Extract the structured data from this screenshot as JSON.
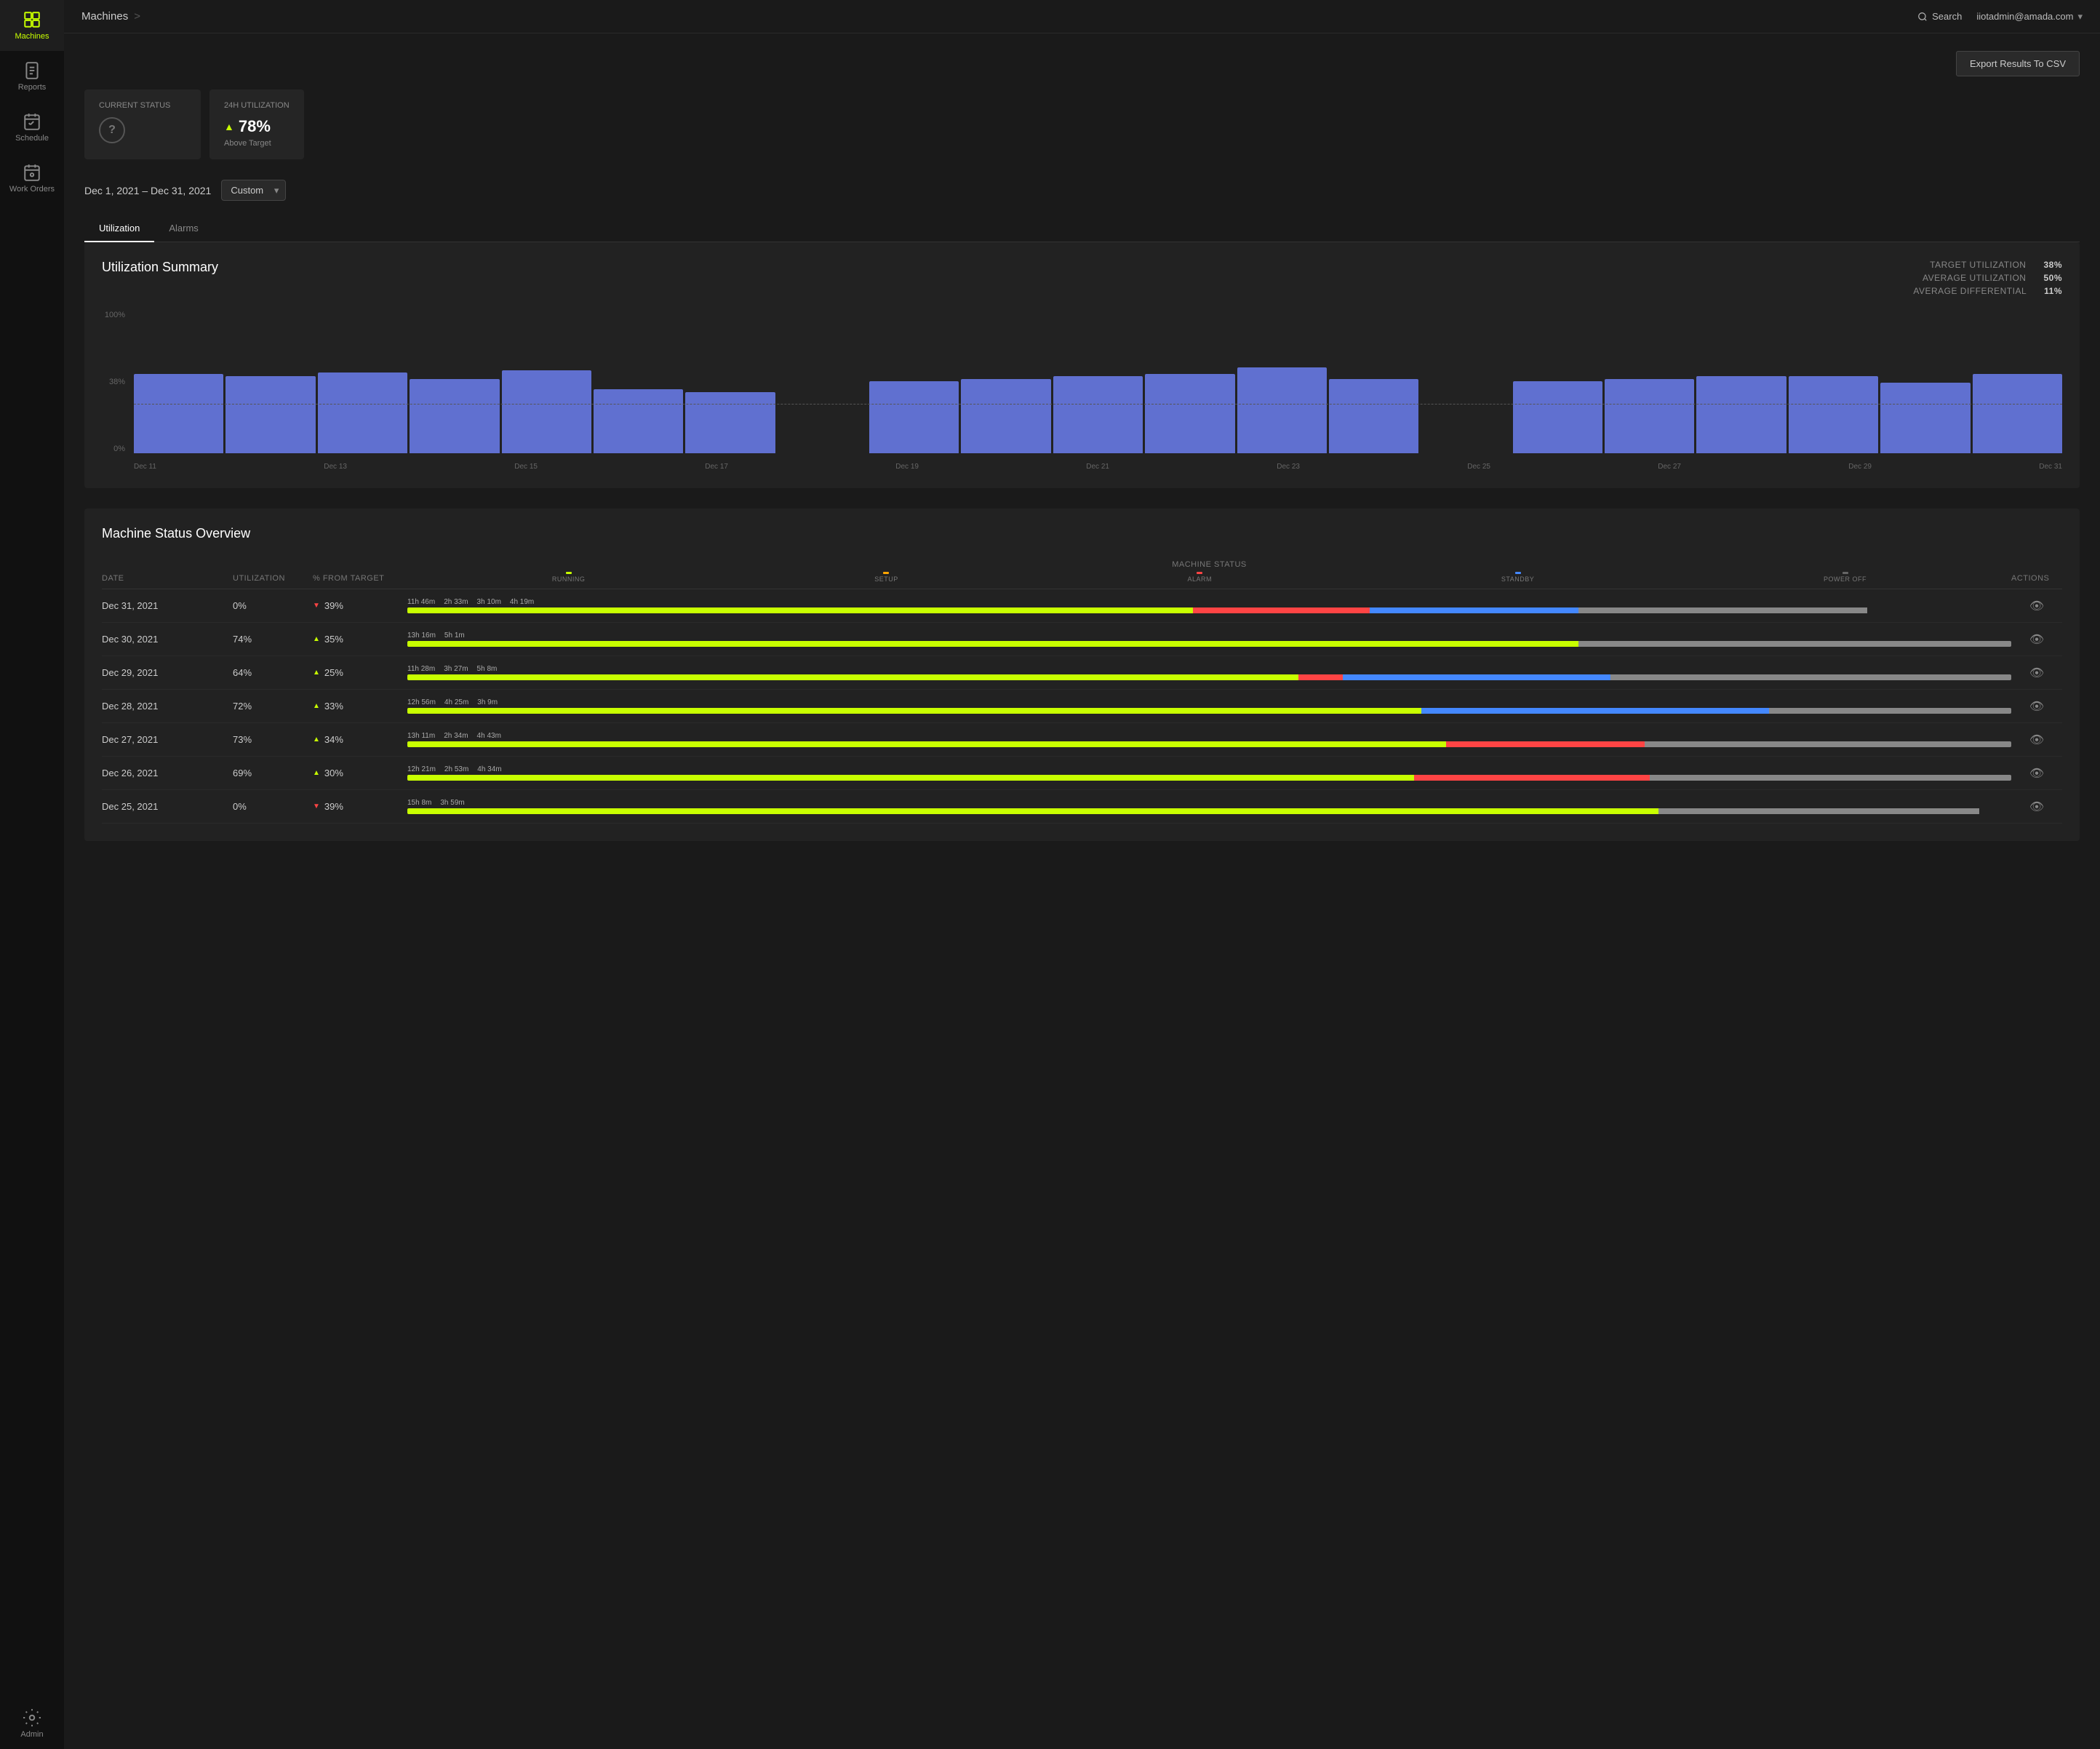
{
  "sidebar": {
    "items": [
      {
        "id": "machines",
        "label": "Machines",
        "active": true
      },
      {
        "id": "reports",
        "label": "Reports",
        "active": false
      },
      {
        "id": "schedule",
        "label": "Schedule",
        "active": false
      },
      {
        "id": "work-orders",
        "label": "Work Orders",
        "active": false
      }
    ],
    "admin_label": "Admin"
  },
  "topbar": {
    "breadcrumb": "Machines",
    "breadcrumb_sep": ">",
    "search_label": "Search",
    "user_email": "iiotadmin@amada.com"
  },
  "export_button": "Export Results To CSV",
  "status_cards": {
    "current_status": {
      "title": "Current Status",
      "icon": "?"
    },
    "utilization_24h": {
      "title": "24h Utilization",
      "value": "78%",
      "trend": "up",
      "label": "Above Target"
    }
  },
  "date_range": {
    "display": "Dec 1, 2021 – Dec 31, 2021",
    "filter_label": "Custom"
  },
  "tabs": [
    {
      "id": "utilization",
      "label": "Utilization",
      "active": true
    },
    {
      "id": "alarms",
      "label": "Alarms",
      "active": false
    }
  ],
  "chart": {
    "title": "Utilization Summary",
    "stats": {
      "target_label": "TARGET UTILIZATION",
      "target_val": "38%",
      "avg_label": "AVERAGE UTILIZATION",
      "avg_val": "50%",
      "diff_label": "AVERAGE DIFFERENTIAL",
      "diff_val": "11%"
    },
    "y_labels": [
      "100%",
      "38%",
      "0%"
    ],
    "target_pct": 38,
    "bars": [
      {
        "label": "Dec 11",
        "height": 62
      },
      {
        "label": "",
        "height": 60
      },
      {
        "label": "Dec 13",
        "height": 63
      },
      {
        "label": "",
        "height": 58
      },
      {
        "label": "Dec 15",
        "height": 65
      },
      {
        "label": "",
        "height": 50
      },
      {
        "label": "Dec 17",
        "height": 48
      },
      {
        "label": "",
        "height": 0
      },
      {
        "label": "Dec 19",
        "height": 56
      },
      {
        "label": "",
        "height": 58
      },
      {
        "label": "Dec 21",
        "height": 60
      },
      {
        "label": "",
        "height": 62
      },
      {
        "label": "Dec 23",
        "height": 67
      },
      {
        "label": "",
        "height": 58
      },
      {
        "label": "Dec 25",
        "height": 0
      },
      {
        "label": "",
        "height": 56
      },
      {
        "label": "Dec 27",
        "height": 58
      },
      {
        "label": "",
        "height": 60
      },
      {
        "label": "Dec 29",
        "height": 60
      },
      {
        "label": "",
        "height": 55
      },
      {
        "label": "Dec 31",
        "height": 62
      }
    ],
    "x_labels": [
      "Dec 11",
      "Dec 13",
      "Dec 15",
      "Dec 17",
      "Dec 19",
      "Dec 21",
      "Dec 23",
      "Dec 25",
      "Dec 27",
      "Dec 29",
      "Dec 31"
    ]
  },
  "machine_overview": {
    "title": "Machine Status Overview",
    "columns": {
      "date": "Date",
      "utilization": "Utilization",
      "from_target": "% from Target",
      "machine_status": "Machine Status",
      "actions": "Actions"
    },
    "status_labels": [
      "RUNNING",
      "SETUP",
      "ALARM",
      "STANDBY",
      "POWER OFF"
    ],
    "rows": [
      {
        "date": "Dec 31, 2021",
        "util": "0%",
        "target_dir": "down",
        "target_val": "39%",
        "running_label": "11h 46m",
        "setup_label": "",
        "alarm_label": "2h 33m",
        "standby_label": "3h 10m",
        "power_label": "4h 19m",
        "running_pct": 49,
        "setup_pct": 0,
        "alarm_pct": 11,
        "standby_pct": 13,
        "power_pct": 18
      },
      {
        "date": "Dec 30, 2021",
        "util": "74%",
        "target_dir": "up",
        "target_val": "35%",
        "running_label": "13h 16m",
        "setup_label": "",
        "alarm_label": "",
        "standby_label": "",
        "power_label": "5h 1m",
        "running_pct": 73,
        "setup_pct": 0,
        "alarm_pct": 0,
        "standby_pct": 0,
        "power_pct": 27
      },
      {
        "date": "Dec 29, 2021",
        "util": "64%",
        "target_dir": "up",
        "target_val": "25%",
        "running_label": "11h 28m",
        "setup_label": "",
        "alarm_label": "",
        "standby_label": "3h 27m",
        "power_label": "5h 8m",
        "running_pct": 60,
        "setup_pct": 0,
        "alarm_pct": 3,
        "standby_pct": 18,
        "power_pct": 27
      },
      {
        "date": "Dec 28, 2021",
        "util": "72%",
        "target_dir": "up",
        "target_val": "33%",
        "running_label": "12h 56m",
        "setup_label": "",
        "alarm_label": "",
        "standby_label": "4h 25m",
        "power_label": "3h 9m",
        "running_pct": 67,
        "setup_pct": 0,
        "alarm_pct": 0,
        "standby_pct": 23,
        "power_pct": 16
      },
      {
        "date": "Dec 27, 2021",
        "util": "73%",
        "target_dir": "up",
        "target_val": "34%",
        "running_label": "13h 11m",
        "setup_label": "",
        "alarm_label": "2h 34m",
        "standby_label": "",
        "power_label": "4h 43m",
        "running_pct": 68,
        "setup_pct": 0,
        "alarm_pct": 13,
        "standby_pct": 0,
        "power_pct": 24
      },
      {
        "date": "Dec 26, 2021",
        "util": "69%",
        "target_dir": "up",
        "target_val": "30%",
        "running_label": "12h 21m",
        "setup_label": "",
        "alarm_label": "2h 53m",
        "standby_label": "",
        "power_label": "4h 34m",
        "running_pct": 64,
        "setup_pct": 0,
        "alarm_pct": 15,
        "standby_pct": 0,
        "power_pct": 23
      },
      {
        "date": "Dec 25, 2021",
        "util": "0%",
        "target_dir": "down",
        "target_val": "39%",
        "running_label": "15h 8m",
        "setup_label": "",
        "alarm_label": "",
        "standby_label": "",
        "power_label": "3h 59m",
        "running_pct": 78,
        "setup_pct": 0,
        "alarm_pct": 0,
        "standby_pct": 0,
        "power_pct": 20
      }
    ]
  }
}
